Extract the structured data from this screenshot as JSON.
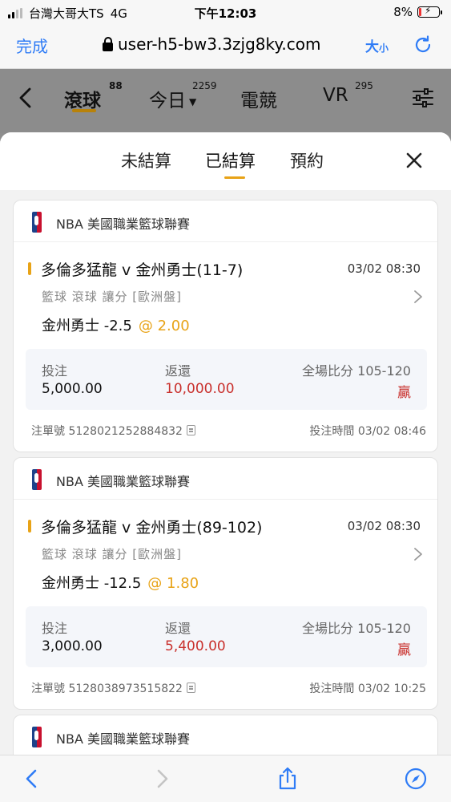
{
  "status_bar": {
    "carrier": "台灣大哥大TS",
    "network": "4G",
    "time": "下午12:03",
    "battery": "8%"
  },
  "browser": {
    "done_label": "完成",
    "url": "user-h5-bw3.3zjg8ky.com",
    "text_size_label": "大",
    "text_size_small": "小"
  },
  "header": {
    "nav": [
      {
        "label": "滾球",
        "badge": "88"
      },
      {
        "label": "今日",
        "badge": "2259"
      },
      {
        "label": "電競",
        "badge": ""
      },
      {
        "label": "VR",
        "badge": "295"
      }
    ]
  },
  "sheet": {
    "tabs": [
      "未結算",
      "已結算",
      "預約"
    ],
    "active_tab": 1
  },
  "bets": [
    {
      "league": "NBA 美國職業籃球聯賽",
      "match": "多倫多猛龍 v 金州勇士(11-7)",
      "match_time": "03/02 08:30",
      "meta": "籃球  滾球  讓分 [歐洲盤]",
      "pick": "金州勇士 -2.5",
      "odds": "@ 2.00",
      "stake_label": "投注",
      "stake": "5,000.00",
      "return_label": "返還",
      "return": "10,000.00",
      "score_label": "全場比分 105-120",
      "result": "贏",
      "ticket": "注單號 5128021252884832",
      "bet_time": "投注時間 03/02 08:46"
    },
    {
      "league": "NBA 美國職業籃球聯賽",
      "match": "多倫多猛龍 v 金州勇士(89-102)",
      "match_time": "03/02 08:30",
      "meta": "籃球  滾球  讓分 [歐洲盤]",
      "pick": "金州勇士 -12.5",
      "odds": "@ 1.80",
      "stake_label": "投注",
      "stake": "3,000.00",
      "return_label": "返還",
      "return": "5,400.00",
      "score_label": "全場比分 105-120",
      "result": "贏",
      "ticket": "注單號 5128038973515822",
      "bet_time": "投注時間 03/02 10:25"
    },
    {
      "league": "NBA 美國職業籃球聯賽"
    }
  ],
  "colors": {
    "accent": "#e8a317",
    "link_blue": "#2f7cf6",
    "win_red": "#c9302c"
  }
}
